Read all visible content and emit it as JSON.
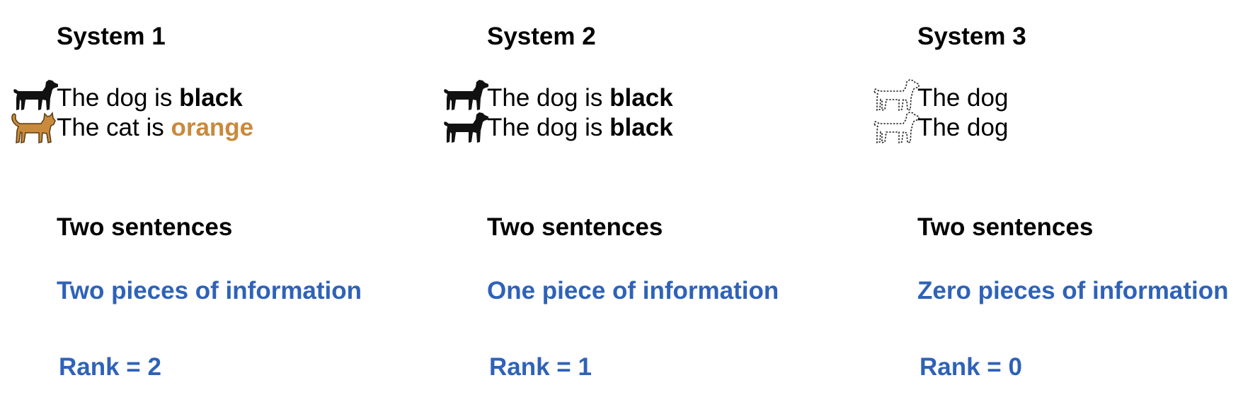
{
  "colors": {
    "text": "#000000",
    "info_blue": "#2f62b8",
    "orange": "#c98a3c"
  },
  "systems": [
    {
      "title": "System 1",
      "sentences": [
        {
          "animal_icon": "dog-icon",
          "subject": "The dog is ",
          "attribute": "black",
          "attr_color": "#000000"
        },
        {
          "animal_icon": "cat-icon",
          "subject": "The cat is ",
          "attribute": "orange",
          "attr_color": "#c98a3c"
        }
      ],
      "count": "Two sentences",
      "info": "Two pieces of information",
      "rank": "Rank = 2"
    },
    {
      "title": "System 2",
      "sentences": [
        {
          "animal_icon": "dog-icon",
          "subject": "The dog is ",
          "attribute": "black",
          "attr_color": "#000000"
        },
        {
          "animal_icon": "dog-icon",
          "subject": "The dog is ",
          "attribute": "black",
          "attr_color": "#000000"
        }
      ],
      "count": "Two sentences",
      "info": "One piece of information",
      "rank": "Rank = 1"
    },
    {
      "title": "System 3",
      "sentences": [
        {
          "animal_icon": "dotted-dog-outline-icon",
          "subject": "The dog",
          "attribute": "",
          "attr_color": "#000000"
        },
        {
          "animal_icon": "dotted-dog-outline-icon",
          "subject": "The dog",
          "attribute": "",
          "attr_color": "#000000"
        }
      ],
      "count": "Two sentences",
      "info": "Zero pieces of information",
      "rank": "Rank = 0"
    }
  ]
}
